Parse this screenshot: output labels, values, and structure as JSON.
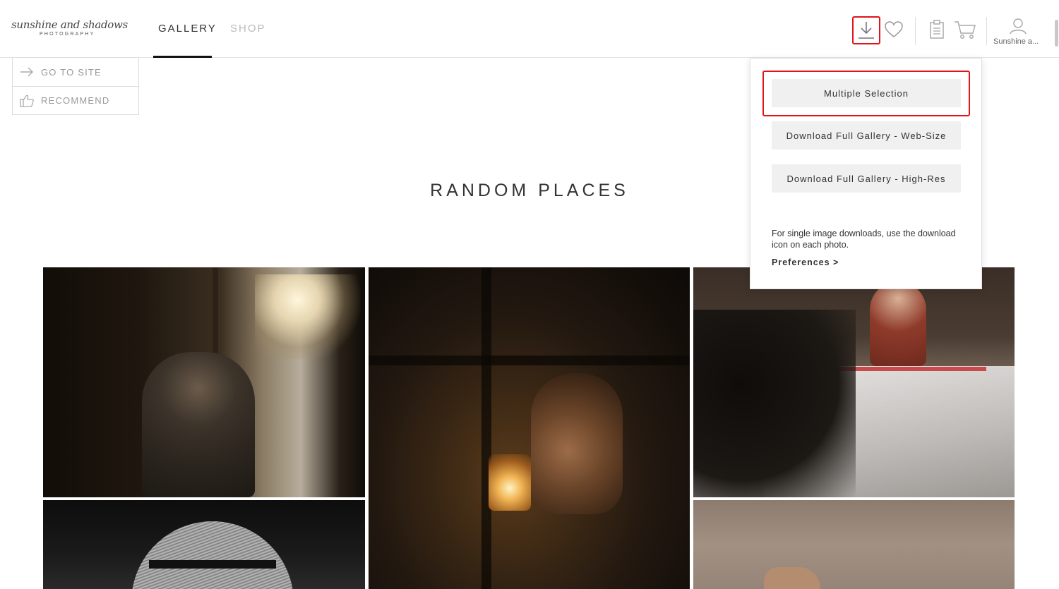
{
  "header": {
    "logo": {
      "script": "sunshine and shadows",
      "sub": "PHOTOGRAPHY"
    },
    "tabs": [
      {
        "label": "GALLERY",
        "active": true
      },
      {
        "label": "SHOP",
        "active": false
      }
    ],
    "icons": [
      "download-icon",
      "heart-icon",
      "clipboard-icon",
      "cart-icon",
      "user-icon"
    ],
    "user_name": "Sunshine a..."
  },
  "side_actions": [
    {
      "label": "GO TO SITE",
      "icon": "arrow-right-icon"
    },
    {
      "label": "RECOMMEND",
      "icon": "thumbs-up-icon"
    }
  ],
  "page_title": "RANDOM PLACES",
  "download_menu": {
    "buttons": [
      "Multiple Selection",
      "Download Full Gallery - Web-Size",
      "Download Full Gallery - High-Res"
    ],
    "note": "For single image downloads, use the download icon on each photo.",
    "preferences_link": "Preferences >"
  },
  "colors": {
    "highlight": "#e1141b",
    "button_bg": "#f0f0f0",
    "active_tab": "#333333",
    "inactive_tab": "#bbbbbb"
  }
}
